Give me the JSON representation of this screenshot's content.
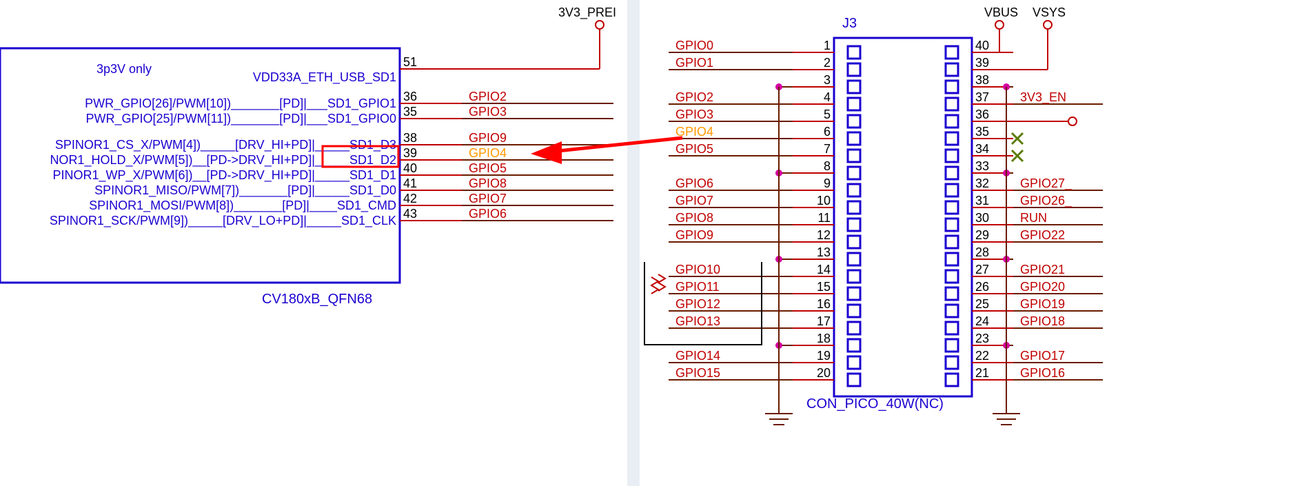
{
  "left_block": {
    "title": "3p3V only",
    "partname": "CV180xB_QFN68",
    "vdd_row": {
      "func": "VDD33A_ETH_USB_SD1",
      "pin": "51",
      "power": "3V3_PREI"
    },
    "gpio_rows": [
      {
        "func": "PWR_GPIO[26]/PWM[10])_______[PD]|___SD1_GPIO1",
        "pin": "36",
        "net": "GPIO2"
      },
      {
        "func": "PWR_GPIO[25]/PWM[11])_______[PD]|___SD1_GPIO0",
        "pin": "35",
        "net": "GPIO3"
      }
    ],
    "sd_rows": [
      {
        "func": "SPINOR1_CS_X/PWM[4])_____[DRV_HI+PD]|_____SD1_D3",
        "pin": "38",
        "net": "GPIO9"
      },
      {
        "func": "NOR1_HOLD_X/PWM[5])__[PD->DRV_HI+PD]|_____SD1_D2",
        "pin": "39",
        "net": "GPIO4",
        "highlight": true
      },
      {
        "func": "PINOR1_WP_X/PWM[6])__[PD->DRV_HI+PD]|_____SD1_D1",
        "pin": "40",
        "net": "GPIO5"
      },
      {
        "func": "SPINOR1_MISO/PWM[7])_______[PD]|_____SD1_D0",
        "pin": "41",
        "net": "GPIO8"
      },
      {
        "func": "SPINOR1_MOSI/PWM[8])_______[PD]|____SD1_CMD",
        "pin": "42",
        "net": "GPIO7"
      },
      {
        "func": "SPINOR1_SCK/PWM[9])_____[DRV_LO+PD]|_____SD1_CLK",
        "pin": "43",
        "net": "GPIO6"
      }
    ]
  },
  "right_block": {
    "refdes": "J3",
    "partname": "CON_PICO_40W(NC)",
    "power_left": "VBUS",
    "power_right": "VSYS",
    "left_pins": [
      {
        "num": "1",
        "net": "GPIO0"
      },
      {
        "num": "2",
        "net": "GPIO1"
      },
      {
        "num": "3",
        "net": ""
      },
      {
        "num": "4",
        "net": "GPIO2"
      },
      {
        "num": "5",
        "net": "GPIO3"
      },
      {
        "num": "6",
        "net": "GPIO4",
        "highlight": true
      },
      {
        "num": "7",
        "net": "GPIO5"
      },
      {
        "num": "8",
        "net": ""
      },
      {
        "num": "9",
        "net": "GPIO6"
      },
      {
        "num": "10",
        "net": "GPIO7"
      },
      {
        "num": "11",
        "net": "GPIO8"
      },
      {
        "num": "12",
        "net": "GPIO9"
      },
      {
        "num": "13",
        "net": ""
      },
      {
        "num": "14",
        "net": "GPIO10"
      },
      {
        "num": "15",
        "net": "GPIO11"
      },
      {
        "num": "16",
        "net": "GPIO12"
      },
      {
        "num": "17",
        "net": "GPIO13"
      },
      {
        "num": "18",
        "net": ""
      },
      {
        "num": "19",
        "net": "GPIO14"
      },
      {
        "num": "20",
        "net": "GPIO15"
      }
    ],
    "right_pins": [
      {
        "num": "40",
        "net": ""
      },
      {
        "num": "39",
        "net": ""
      },
      {
        "num": "38",
        "net": ""
      },
      {
        "num": "37",
        "net": "3V3_EN"
      },
      {
        "num": "36",
        "net": ""
      },
      {
        "num": "35",
        "net": "",
        "nc": true
      },
      {
        "num": "34",
        "net": "",
        "nc": true
      },
      {
        "num": "33",
        "net": ""
      },
      {
        "num": "32",
        "net": "GPIO27_"
      },
      {
        "num": "31",
        "net": "GPIO26_"
      },
      {
        "num": "30",
        "net": "RUN"
      },
      {
        "num": "29",
        "net": "GPIO22"
      },
      {
        "num": "28",
        "net": ""
      },
      {
        "num": "27",
        "net": "GPIO21"
      },
      {
        "num": "26",
        "net": "GPIO20"
      },
      {
        "num": "25",
        "net": "GPIO19"
      },
      {
        "num": "24",
        "net": "GPIO18"
      },
      {
        "num": "23",
        "net": ""
      },
      {
        "num": "22",
        "net": "GPIO17"
      },
      {
        "num": "21",
        "net": "GPIO16"
      }
    ]
  }
}
